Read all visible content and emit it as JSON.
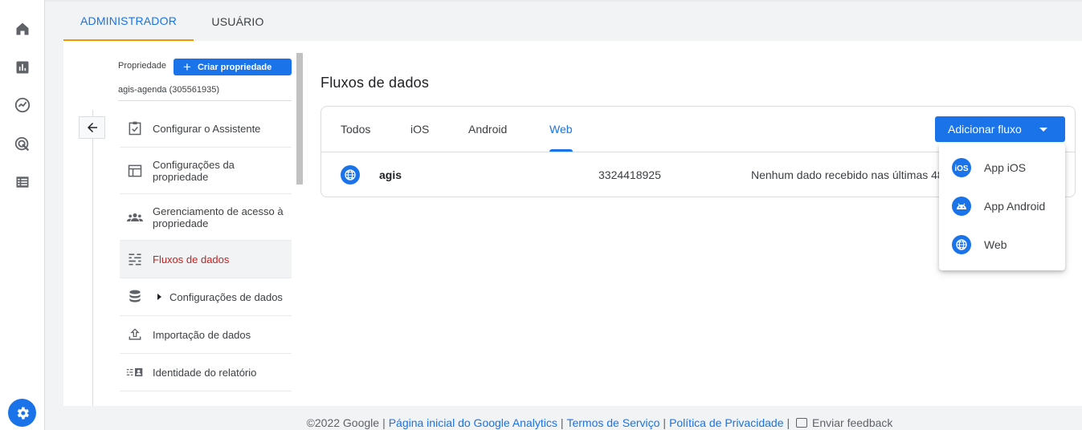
{
  "nav_rail": {
    "items": [
      {
        "icon": "home-icon"
      },
      {
        "icon": "reports-icon"
      },
      {
        "icon": "explore-icon"
      },
      {
        "icon": "advertising-icon"
      },
      {
        "icon": "list-icon"
      }
    ],
    "settings_icon": "gear-icon"
  },
  "tabs": {
    "admin": "ADMINISTRADOR",
    "user": "USUÁRIO"
  },
  "property": {
    "label": "Propriedade",
    "create_button": "Criar propriedade",
    "name": "agis-agenda (305561935)"
  },
  "sidebar": {
    "items": [
      {
        "label": "Configurar o Assistente",
        "icon": "clipboard-check-icon"
      },
      {
        "label": "Configurações da propriedade",
        "icon": "layout-icon"
      },
      {
        "label": "Gerenciamento de acesso à propriedade",
        "icon": "people-icon"
      },
      {
        "label": "Fluxos de dados",
        "icon": "streams-icon"
      },
      {
        "label": "Configurações de dados",
        "icon": "database-icon"
      },
      {
        "label": "Importação de dados",
        "icon": "upload-icon"
      },
      {
        "label": "Identidade do relatório",
        "icon": "identity-icon"
      }
    ]
  },
  "main": {
    "title": "Fluxos de dados",
    "filter_tabs": [
      "Todos",
      "iOS",
      "Android",
      "Web"
    ],
    "selected_tab": "Web",
    "add_button": "Adicionar fluxo",
    "streams": [
      {
        "name": "agis",
        "id": "3324418925",
        "status": "Nenhum dado recebido nas últimas 48 horas",
        "icon": "globe-icon"
      }
    ],
    "add_menu": [
      {
        "label": "App iOS",
        "icon": "ios-icon"
      },
      {
        "label": "App Android",
        "icon": "android-icon"
      },
      {
        "label": "Web",
        "icon": "globe-icon"
      }
    ]
  },
  "footer": {
    "copyright": "©2022 Google",
    "links": [
      "Página inicial do Google Analytics",
      "Termos de Serviço",
      "Política de Privacidade"
    ],
    "feedback": "Enviar feedback"
  },
  "colors": {
    "accent": "#1a73e8",
    "tab_underline": "#f29900",
    "active_item": "#c5221f"
  }
}
